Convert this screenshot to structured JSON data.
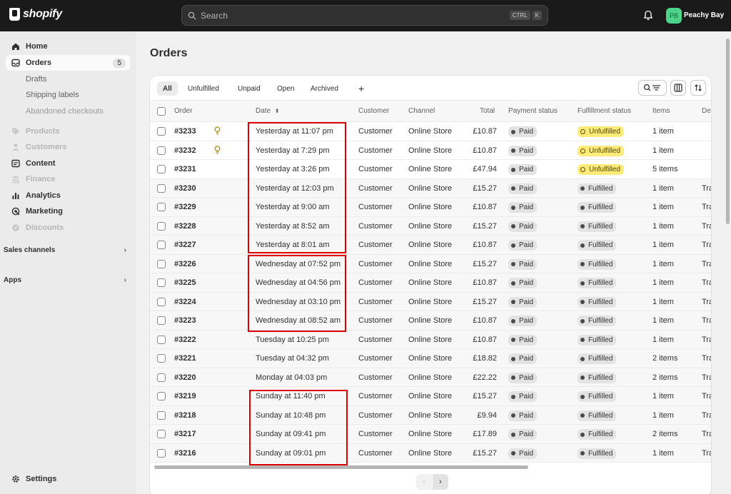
{
  "topbar": {
    "brand": "shopify",
    "search_placeholder": "Search",
    "shortcut_keys": [
      "CTRL",
      "K"
    ],
    "avatar_initials": "PB",
    "store_name": "Peachy Bay"
  },
  "sidebar": {
    "items": [
      {
        "label": "Home",
        "icon": "home-icon"
      },
      {
        "label": "Orders",
        "icon": "orders-icon",
        "badge": "5"
      },
      {
        "label": "Drafts"
      },
      {
        "label": "Shipping labels"
      },
      {
        "label": "Abandoned checkouts"
      },
      {
        "label": "Products",
        "icon": "tag-icon"
      },
      {
        "label": "Customers",
        "icon": "person-icon"
      },
      {
        "label": "Content",
        "icon": "content-icon"
      },
      {
        "label": "Finance",
        "icon": "bank-icon"
      },
      {
        "label": "Analytics",
        "icon": "bar-chart-icon"
      },
      {
        "label": "Marketing",
        "icon": "target-icon"
      },
      {
        "label": "Discounts",
        "icon": "discount-icon"
      }
    ],
    "sales_channels": "Sales channels",
    "apps": "Apps",
    "settings": "Settings"
  },
  "page": {
    "title": "Orders",
    "tabs": [
      "All",
      "Unfulfilled",
      "Unpaid",
      "Open",
      "Archived",
      "+"
    ],
    "columns": [
      "Order",
      "Date",
      "Customer",
      "Channel",
      "Total",
      "Payment status",
      "Fulfillment status",
      "Items",
      "De"
    ]
  },
  "orders": [
    {
      "order": "#3233",
      "date": "Yesterday at 11:07 pm",
      "customer": "Customer",
      "channel": "Online Store",
      "total": "£10.87",
      "payment": "Paid",
      "fulfillment": "Unfulfilled",
      "items": "1 item",
      "delivery": "",
      "note": true
    },
    {
      "order": "#3232",
      "date": "Yesterday at 7:29 pm",
      "customer": "Customer",
      "channel": "Online Store",
      "total": "£10.87",
      "payment": "Paid",
      "fulfillment": "Unfulfilled",
      "items": "1 item",
      "delivery": "",
      "note": true
    },
    {
      "order": "#3231",
      "date": "Yesterday at 3:26 pm",
      "customer": "Customer",
      "channel": "Online Store",
      "total": "£47.94",
      "payment": "Paid",
      "fulfillment": "Unfulfilled",
      "items": "5 items",
      "delivery": ""
    },
    {
      "order": "#3230",
      "date": "Yesterday at 12:03 pm",
      "customer": "Customer",
      "channel": "Online Store",
      "total": "£15.27",
      "payment": "Paid",
      "fulfillment": "Fulfilled",
      "items": "1 item",
      "delivery": "Tra"
    },
    {
      "order": "#3229",
      "date": "Yesterday at 9:00 am",
      "customer": "Customer",
      "channel": "Online Store",
      "total": "£10.87",
      "payment": "Paid",
      "fulfillment": "Fulfilled",
      "items": "1 item",
      "delivery": "Tra"
    },
    {
      "order": "#3228",
      "date": "Yesterday at 8:52 am",
      "customer": "Customer",
      "channel": "Online Store",
      "total": "£15.27",
      "payment": "Paid",
      "fulfillment": "Fulfilled",
      "items": "1 item",
      "delivery": "Tra"
    },
    {
      "order": "#3227",
      "date": "Yesterday at 8:01 am",
      "customer": "Customer",
      "channel": "Online Store",
      "total": "£10.87",
      "payment": "Paid",
      "fulfillment": "Fulfilled",
      "items": "1 item",
      "delivery": "Tra"
    },
    {
      "order": "#3226",
      "date": "Wednesday at 07:52 pm",
      "customer": "Customer",
      "channel": "Online Store",
      "total": "£15.27",
      "payment": "Paid",
      "fulfillment": "Fulfilled",
      "items": "1 item",
      "delivery": "Tra"
    },
    {
      "order": "#3225",
      "date": "Wednesday at 04:56 pm",
      "customer": "Customer",
      "channel": "Online Store",
      "total": "£10.87",
      "payment": "Paid",
      "fulfillment": "Fulfilled",
      "items": "1 item",
      "delivery": "Tra"
    },
    {
      "order": "#3224",
      "date": "Wednesday at 03:10 pm",
      "customer": "Customer",
      "channel": "Online Store",
      "total": "£15.27",
      "payment": "Paid",
      "fulfillment": "Fulfilled",
      "items": "1 item",
      "delivery": "Tra"
    },
    {
      "order": "#3223",
      "date": "Wednesday at 08:52 am",
      "customer": "Customer",
      "channel": "Online Store",
      "total": "£10.87",
      "payment": "Paid",
      "fulfillment": "Fulfilled",
      "items": "1 item",
      "delivery": "Tra"
    },
    {
      "order": "#3222",
      "date": "Tuesday at 10:25 pm",
      "customer": "Customer",
      "channel": "Online Store",
      "total": "£10.87",
      "payment": "Paid",
      "fulfillment": "Fulfilled",
      "items": "1 item",
      "delivery": "Tra"
    },
    {
      "order": "#3221",
      "date": "Tuesday at 04:32 pm",
      "customer": "Customer",
      "channel": "Online Store",
      "total": "£18.82",
      "payment": "Paid",
      "fulfillment": "Fulfilled",
      "items": "2 items",
      "delivery": "Tra"
    },
    {
      "order": "#3220",
      "date": "Monday at 04:03 pm",
      "customer": "Customer",
      "channel": "Online Store",
      "total": "£22.22",
      "payment": "Paid",
      "fulfillment": "Fulfilled",
      "items": "2 items",
      "delivery": "Tra"
    },
    {
      "order": "#3219",
      "date": "Sunday at 11:40 pm",
      "customer": "Customer",
      "channel": "Online Store",
      "total": "£15.27",
      "payment": "Paid",
      "fulfillment": "Fulfilled",
      "items": "1 item",
      "delivery": "Tra"
    },
    {
      "order": "#3218",
      "date": "Sunday at 10:48 pm",
      "customer": "Customer",
      "channel": "Online Store",
      "total": "£9.94",
      "payment": "Paid",
      "fulfillment": "Fulfilled",
      "items": "1 item",
      "delivery": "Tra"
    },
    {
      "order": "#3217",
      "date": "Sunday at 09:41 pm",
      "customer": "Customer",
      "channel": "Online Store",
      "total": "£17.89",
      "payment": "Paid",
      "fulfillment": "Fulfilled",
      "items": "2 items",
      "delivery": "Tra"
    },
    {
      "order": "#3216",
      "date": "Sunday at 09:01 pm",
      "customer": "Customer",
      "channel": "Online Store",
      "total": "£15.27",
      "payment": "Paid",
      "fulfillment": "Fulfilled",
      "items": "1 item",
      "delivery": "Tra"
    }
  ],
  "colors": {
    "highlight": "#e00000",
    "unfulfilled": "#ffeb78",
    "avatar": "#4cd48a"
  }
}
